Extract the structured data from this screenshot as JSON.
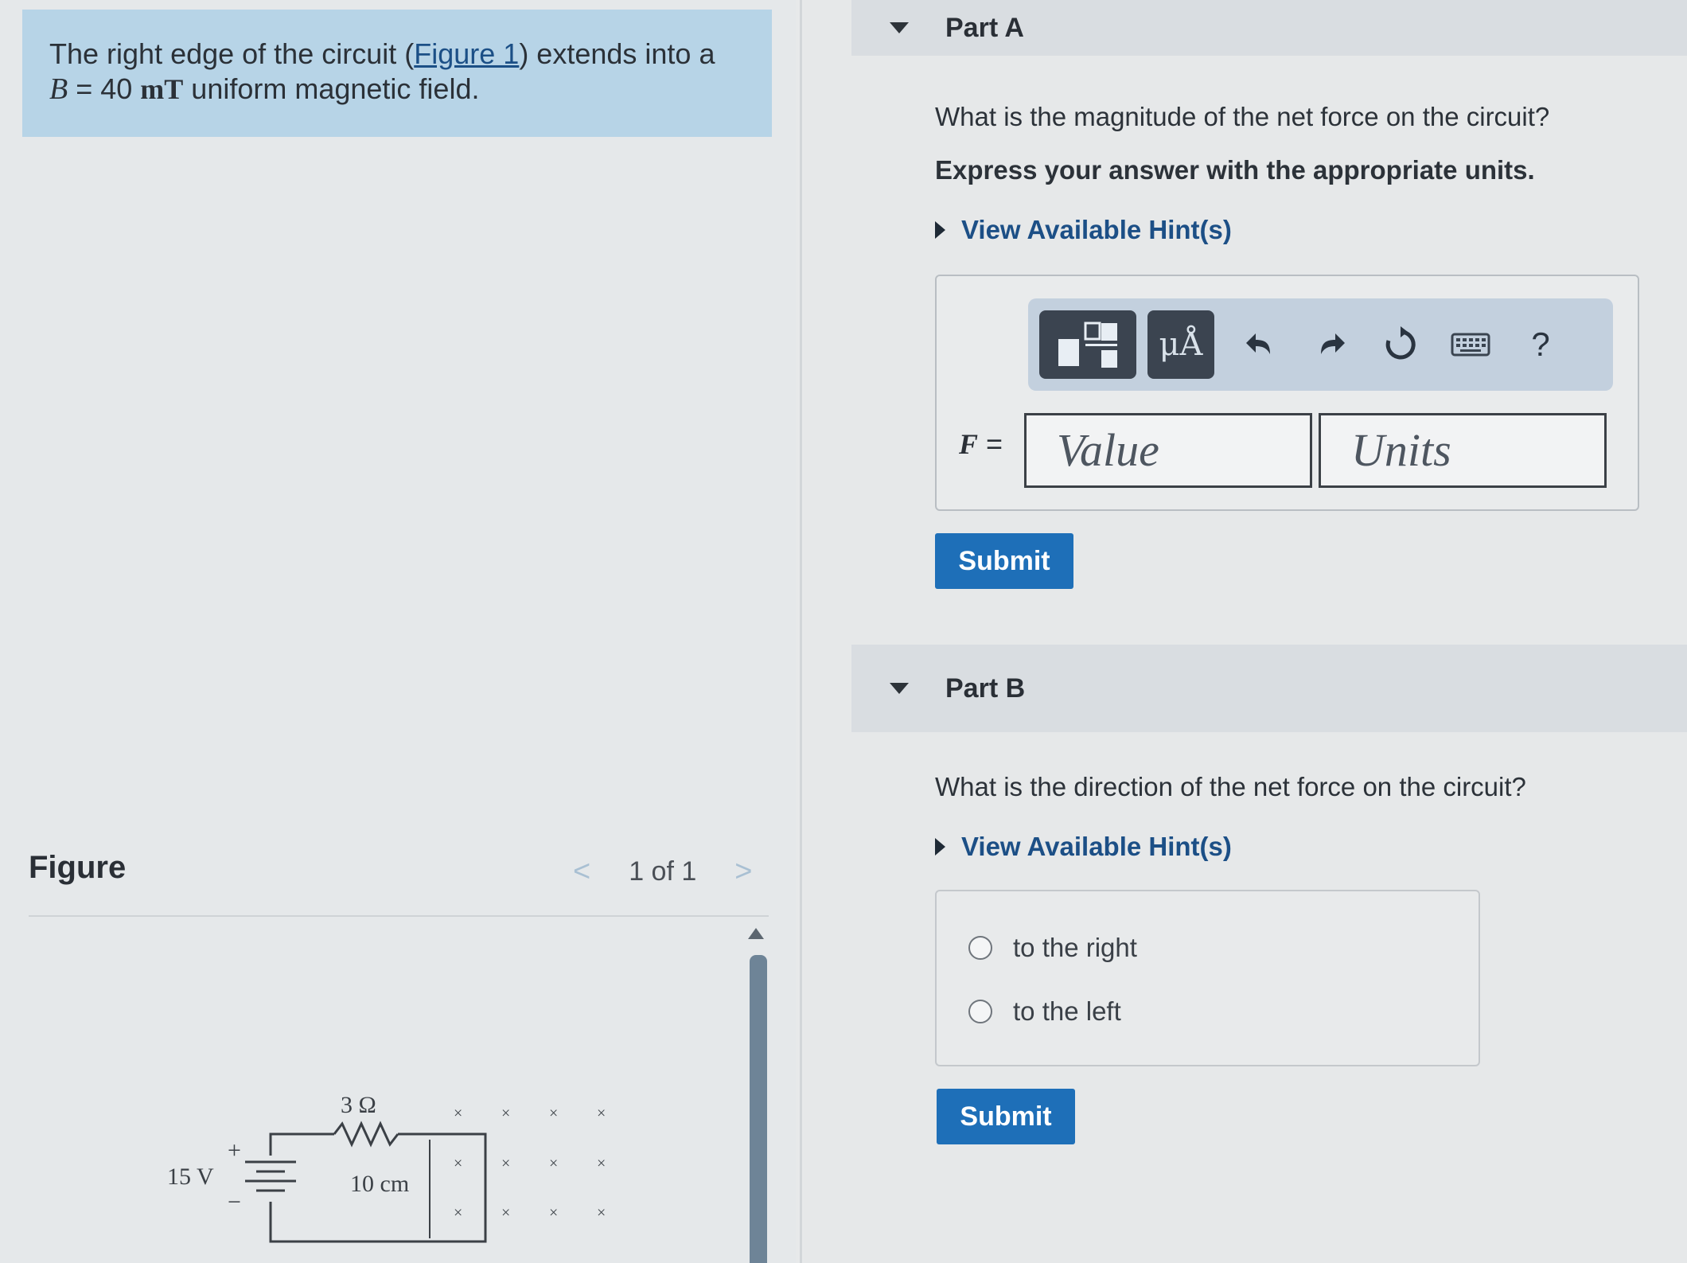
{
  "intro": {
    "line1_start": "The right edge of the circuit (",
    "figure_link": "Figure 1",
    "line1_end": ") extends into a",
    "b_symbol": "B",
    "b_equals": " = 40 ",
    "b_unit": "mT",
    "line2_end": " uniform magnetic field."
  },
  "figure": {
    "label": "Figure",
    "pager_text": "1 of 1",
    "prev_arrow": "<",
    "next_arrow": ">",
    "circuit": {
      "resistor_label": "3 Ω",
      "battery_label": "15 V",
      "plus": "+",
      "minus": "−",
      "length_label": "10 cm",
      "field_marker": "×"
    }
  },
  "partA": {
    "title": "Part A",
    "question": "What is the magnitude of the net force on the circuit?",
    "instruction": "Express your answer with the appropriate units.",
    "hint": "View Available Hint(s)",
    "toolbar": {
      "units_button": "μÅ",
      "help": "?",
      "icons": [
        "templates-icon",
        "units-icon",
        "undo-icon",
        "redo-icon",
        "reset-icon",
        "keyboard-icon",
        "help-icon"
      ]
    },
    "var_symbol": "F",
    "equals": " =",
    "value_placeholder": "Value",
    "units_placeholder": "Units",
    "submit": "Submit"
  },
  "partB": {
    "title": "Part B",
    "question": "What is the direction of the net force on the circuit?",
    "hint": "View Available Hint(s)",
    "options": [
      "to the right",
      "to the left"
    ],
    "submit": "Submit"
  },
  "colors": {
    "intro_bg": "#b7d4e7",
    "link": "#1c4f86",
    "submit_bg": "#1e6fb8",
    "toolbar_bg": "#c3d0de"
  }
}
